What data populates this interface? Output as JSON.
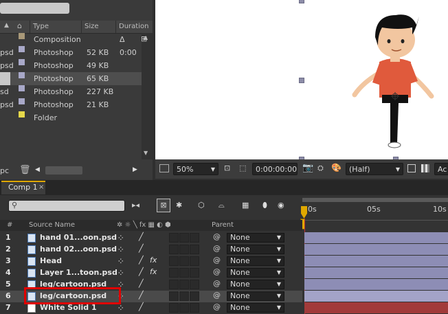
{
  "project": {
    "columns": {
      "type": "Type",
      "size": "Size",
      "duration": "Duration"
    },
    "rows": [
      {
        "name": "",
        "type": "Composition",
        "size": "",
        "duration": "Δ 0:00",
        "color": "#a89878"
      },
      {
        "name": "psd",
        "type": "Photoshop",
        "size": "52 KB",
        "duration": "",
        "color": "#a8a8c8"
      },
      {
        "name": "psd",
        "type": "Photoshop",
        "size": "49 KB",
        "duration": "",
        "color": "#a8a8c8"
      },
      {
        "name": "",
        "type": "Photoshop",
        "size": "65 KB",
        "duration": "",
        "color": "#a8a8c8"
      },
      {
        "name": "sd",
        "type": "Photoshop",
        "size": "227 KB",
        "duration": "",
        "color": "#a8a8c8"
      },
      {
        "name": "psd",
        "type": "Photoshop",
        "size": "21 KB",
        "duration": "",
        "color": "#a8a8c8"
      },
      {
        "name": "",
        "type": "Folder",
        "size": "",
        "duration": "",
        "color": "#e6d84a"
      }
    ],
    "footer_label": "pc"
  },
  "viewer": {
    "zoom": "50%",
    "timecode": "0:00:00:00",
    "resolution": "(Half)",
    "extra": "Ac"
  },
  "timeline": {
    "tab_label": "Comp 1",
    "header": {
      "num": "#",
      "source_name": "Source Name",
      "parent": "Parent"
    },
    "ruler": {
      "t0": "0s",
      "t1": "05s",
      "t2": "10s"
    },
    "layers": [
      {
        "num": "1",
        "name": "hand 01...oon.psd",
        "fx": false,
        "parent": "None"
      },
      {
        "num": "2",
        "name": "hand 02...oon.psd",
        "fx": false,
        "parent": "None"
      },
      {
        "num": "3",
        "name": "Head",
        "fx": true,
        "parent": "None"
      },
      {
        "num": "4",
        "name": "Layer 1...toon.psd",
        "fx": true,
        "parent": "None"
      },
      {
        "num": "5",
        "name": "leg/cartoon.psd",
        "fx": false,
        "parent": "None"
      },
      {
        "num": "6",
        "name": "leg/cartoon.psd",
        "fx": false,
        "parent": "None"
      },
      {
        "num": "7",
        "name": "White Solid 1",
        "fx": false,
        "parent": "None"
      }
    ]
  }
}
